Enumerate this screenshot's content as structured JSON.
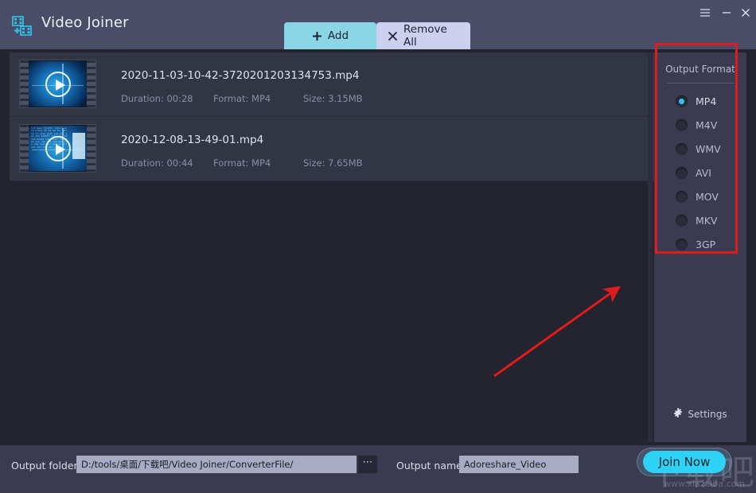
{
  "window": {
    "title": "Video Joiner",
    "logo_icon": "film-plus-icon",
    "menu_icon": "hamburger-menu-icon",
    "minimize_icon": "minimize-icon",
    "close_icon": "close-icon"
  },
  "toolbar": {
    "add_label": "Add",
    "add_icon": "plus-icon",
    "remove_all_label": "Remove All",
    "remove_all_icon": "close-x-icon",
    "add_color": "#8ad6e6",
    "remove_color": "#ccd0ee"
  },
  "files": [
    {
      "name": "2020-11-03-10-42-3720201203134753.mp4",
      "duration_label": "Duration: 00:28",
      "format_label": "Format: MP4",
      "size_label": "Size:  3.15MB",
      "thumb_icon": "video-thumbnail-play-icon"
    },
    {
      "name": "2020-12-08-13-49-01.mp4",
      "duration_label": "Duration: 00:44",
      "format_label": "Format: MP4",
      "size_label": "Size:  7.65MB",
      "thumb_icon": "video-thumbnail-play-icon"
    }
  ],
  "output_format": {
    "title": "Output Format",
    "highlight_color": "#e01b1b",
    "selected": "MP4",
    "options": [
      {
        "label": "MP4",
        "selected": true
      },
      {
        "label": "M4V",
        "selected": false
      },
      {
        "label": "WMV",
        "selected": false
      },
      {
        "label": "AVI",
        "selected": false
      },
      {
        "label": "MOV",
        "selected": false
      },
      {
        "label": "MKV",
        "selected": false
      },
      {
        "label": "3GP",
        "selected": false
      }
    ]
  },
  "settings": {
    "label": "Settings",
    "icon": "gear-icon"
  },
  "bottom": {
    "output_folder_label": "Output folder:",
    "output_folder_value": "D:/tools/桌面/下载吧/Video Joiner/ConverterFile/",
    "browse_label": "⋯",
    "output_name_label": "Output name:",
    "output_name_value": "Adoreshare_Video",
    "join_label": "Join Now",
    "join_color": "#2ed2f5"
  },
  "watermark": {
    "cn_text": "下载吧",
    "url_text": "www.xiazaiba.com"
  },
  "annotation": {
    "arrow_color": "#e01b1b",
    "from": "620,473",
    "to": "778,361"
  }
}
